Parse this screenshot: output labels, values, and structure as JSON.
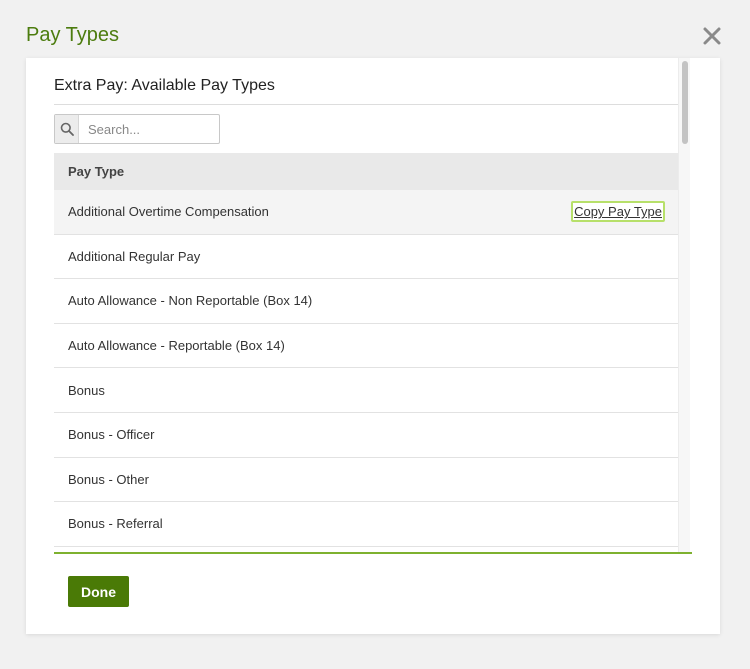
{
  "modal": {
    "title": "Pay Types"
  },
  "panel": {
    "section_title": "Extra Pay: Available Pay Types",
    "search": {
      "placeholder": "Search...",
      "value": ""
    },
    "table": {
      "header": "Pay Type",
      "rows": [
        "Additional Overtime Compensation",
        "Additional Regular Pay",
        "Auto Allowance - Non Reportable (Box 14)",
        "Auto Allowance - Reportable (Box 14)",
        "Bonus",
        "Bonus - Officer",
        "Bonus - Other",
        "Bonus - Referral"
      ],
      "hover_action_label": "Copy Pay Type"
    },
    "done_label": "Done"
  },
  "colors": {
    "title_green": "#4c7c0e",
    "button_green": "#4a7a06",
    "accent_rule": "#7eb12f",
    "focus_outline": "#b7e06a"
  },
  "icons": {
    "close": "close-icon",
    "search": "search-icon"
  }
}
